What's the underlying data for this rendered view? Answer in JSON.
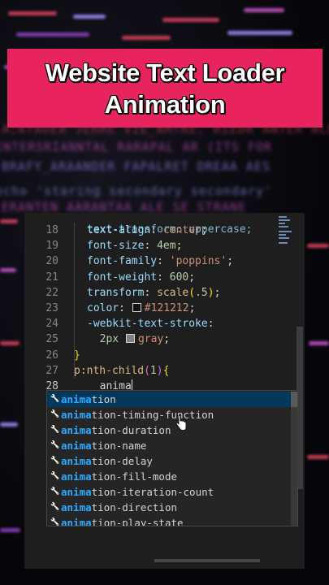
{
  "banner": {
    "line1": "Website Text Loader",
    "line2": "Animation"
  },
  "background_code": [
    {
      "text": "A;ATAUEA JERRE VIE_AMTRE, RIEDR ANTER ALES",
      "color": "#c23b54"
    },
    {
      "text": "ENTERSRIANNTAL RARAPAL AR (ITS FOR",
      "color": "#b04bb0"
    },
    {
      "text": "BRAFY_ARAANDER FAPALRET DREAA AES",
      "color": "#8c7be0"
    },
    {
      "text": "echo 'staring secondary secondary'",
      "color": "#7d8ad8"
    },
    {
      "text": "ERANTEN AARANTAA ALE SE STRANE",
      "color": "#b24db0"
    }
  ],
  "editor": {
    "lines": [
      {
        "n": "18",
        "parts": [
          {
            "t": "text-align",
            "c": "prop"
          },
          {
            "t": ": ",
            "c": "punc"
          },
          {
            "t": "center",
            "c": "val"
          },
          {
            "t": ";",
            "c": "punc"
          }
        ]
      },
      {
        "n": "19",
        "parts": [
          {
            "t": "font-size",
            "c": "prop"
          },
          {
            "t": ": ",
            "c": "punc"
          },
          {
            "t": "4em",
            "c": "num"
          },
          {
            "t": ";",
            "c": "punc"
          }
        ]
      },
      {
        "n": "20",
        "parts": [
          {
            "t": "font-family",
            "c": "prop"
          },
          {
            "t": ": ",
            "c": "punc"
          },
          {
            "t": "'poppins'",
            "c": "val"
          },
          {
            "t": ";",
            "c": "punc"
          }
        ]
      },
      {
        "n": "21",
        "parts": [
          {
            "t": "font-weight",
            "c": "prop"
          },
          {
            "t": ": ",
            "c": "punc"
          },
          {
            "t": "600",
            "c": "num"
          },
          {
            "t": ";",
            "c": "punc"
          }
        ]
      },
      {
        "n": "22",
        "parts": [
          {
            "t": "transform",
            "c": "prop"
          },
          {
            "t": ": ",
            "c": "punc"
          },
          {
            "t": "scale",
            "c": "sel"
          },
          {
            "t": "(",
            "c": "brace2"
          },
          {
            "t": ".5",
            "c": "num"
          },
          {
            "t": ")",
            "c": "brace2"
          },
          {
            "t": ";",
            "c": "punc"
          }
        ]
      },
      {
        "n": "23",
        "parts": [
          {
            "t": "color",
            "c": "prop"
          },
          {
            "t": ": ",
            "c": "punc"
          },
          {
            "swatch": "#121212"
          },
          {
            "t": "#121212",
            "c": "val"
          },
          {
            "t": ";",
            "c": "punc"
          }
        ]
      },
      {
        "n": "24",
        "parts": [
          {
            "t": "-webkit-text-stroke",
            "c": "prop"
          },
          {
            "t": ":",
            "c": "punc"
          }
        ]
      },
      {
        "n": "25",
        "parts": [
          {
            "t": "  2px ",
            "c": "num"
          },
          {
            "swatch": "#808080"
          },
          {
            "t": "gray",
            "c": "val"
          },
          {
            "t": ";",
            "c": "punc"
          }
        ]
      },
      {
        "n": "26",
        "parts": [
          {
            "t": "}",
            "c": "brace2"
          }
        ],
        "outdent": true
      },
      {
        "n": "27",
        "parts": [
          {
            "t": "p:nth-child",
            "c": "sel"
          },
          {
            "t": "(",
            "c": "brace"
          },
          {
            "t": "1",
            "c": "num"
          },
          {
            "t": ")",
            "c": "brace"
          },
          {
            "t": "{",
            "c": "brace2"
          }
        ],
        "outdent": true
      },
      {
        "n": "28",
        "parts": [
          {
            "t": "  anima",
            "c": "punc"
          },
          {
            "caret": true
          }
        ],
        "active": true
      }
    ],
    "partial_top_line": "text-transform: uppercase;"
  },
  "suggestions": {
    "typed": "anima",
    "items": [
      "animation",
      "animation-timing-function",
      "animation-duration",
      "animation-name",
      "animation-delay",
      "animation-fill-mode",
      "animation-iteration-count",
      "animation-direction",
      "animation-play-state"
    ],
    "selected_index": 0,
    "icon": "wrench-icon"
  },
  "colors": {
    "banner": "#e8245f",
    "editor_bg": "#1e1e1e",
    "selection": "#04395e",
    "match": "#2aaaff"
  }
}
